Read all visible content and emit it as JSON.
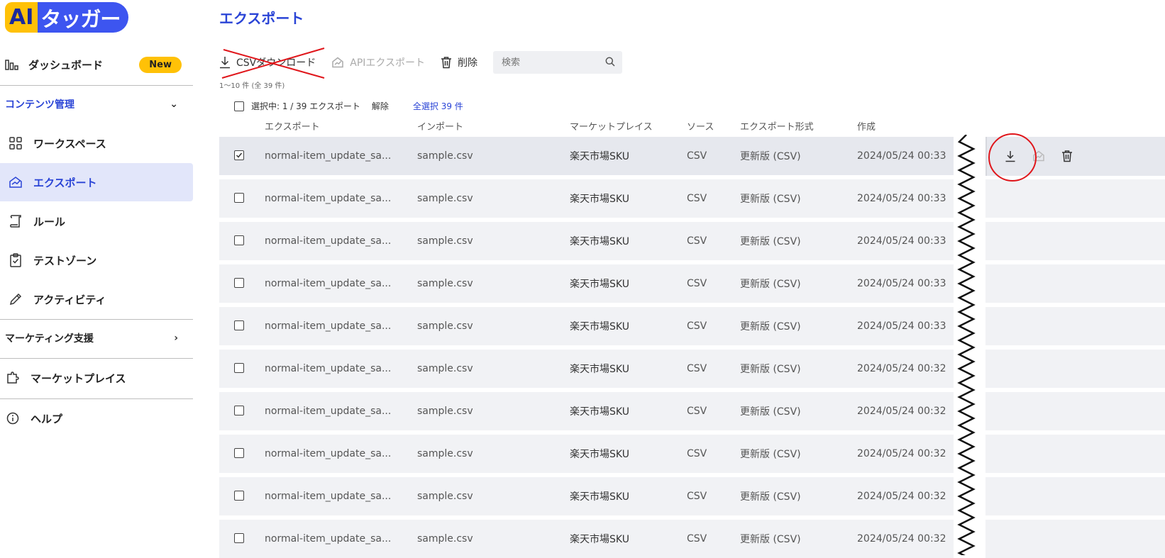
{
  "logo": {
    "ai": "AI",
    "name": "タッガー"
  },
  "sidebar": {
    "dashboard": {
      "label": "ダッシュボード",
      "badge": "New"
    },
    "content_section": "コンテンツ管理",
    "items": [
      {
        "label": "ワークスペース",
        "icon": "grid-icon"
      },
      {
        "label": "エクスポート",
        "icon": "export-icon"
      },
      {
        "label": "ルール",
        "icon": "scroll-icon"
      },
      {
        "label": "テストゾーン",
        "icon": "clipboard-check-icon"
      },
      {
        "label": "アクティビティ",
        "icon": "pencil-icon"
      }
    ],
    "marketing_section": "マーケティング支援",
    "marketplace": "マーケットプレイス",
    "help": "ヘルプ"
  },
  "page": {
    "title": "エクスポート"
  },
  "toolbar": {
    "csv_download": "CSVダウンロード",
    "api_export": "APIエクスポート",
    "delete": "削除",
    "search_placeholder": "検索",
    "range": "1〜10 件 (全 39 件)"
  },
  "selection": {
    "label": "選択中: 1 / 39 エクスポート",
    "clear": "解除",
    "select_all": "全選択 39 件"
  },
  "columns": [
    "エクスポート",
    "インポート",
    "マーケットプレイス",
    "ソース",
    "エクスポート形式",
    "作成"
  ],
  "rows": [
    {
      "export": "normal-item_update_sa...",
      "import": "sample.csv",
      "marketplace": "楽天市場SKU",
      "source": "CSV",
      "format": "更新版 (CSV)",
      "created": "2024/05/24 00:33",
      "checked": true
    },
    {
      "export": "normal-item_update_sa...",
      "import": "sample.csv",
      "marketplace": "楽天市場SKU",
      "source": "CSV",
      "format": "更新版 (CSV)",
      "created": "2024/05/24 00:33",
      "checked": false
    },
    {
      "export": "normal-item_update_sa...",
      "import": "sample.csv",
      "marketplace": "楽天市場SKU",
      "source": "CSV",
      "format": "更新版 (CSV)",
      "created": "2024/05/24 00:33",
      "checked": false
    },
    {
      "export": "normal-item_update_sa...",
      "import": "sample.csv",
      "marketplace": "楽天市場SKU",
      "source": "CSV",
      "format": "更新版 (CSV)",
      "created": "2024/05/24 00:33",
      "checked": false
    },
    {
      "export": "normal-item_update_sa...",
      "import": "sample.csv",
      "marketplace": "楽天市場SKU",
      "source": "CSV",
      "format": "更新版 (CSV)",
      "created": "2024/05/24 00:33",
      "checked": false
    },
    {
      "export": "normal-item_update_sa...",
      "import": "sample.csv",
      "marketplace": "楽天市場SKU",
      "source": "CSV",
      "format": "更新版 (CSV)",
      "created": "2024/05/24 00:32",
      "checked": false
    },
    {
      "export": "normal-item_update_sa...",
      "import": "sample.csv",
      "marketplace": "楽天市場SKU",
      "source": "CSV",
      "format": "更新版 (CSV)",
      "created": "2024/05/24 00:32",
      "checked": false
    },
    {
      "export": "normal-item_update_sa...",
      "import": "sample.csv",
      "marketplace": "楽天市場SKU",
      "source": "CSV",
      "format": "更新版 (CSV)",
      "created": "2024/05/24 00:32",
      "checked": false
    },
    {
      "export": "normal-item_update_sa...",
      "import": "sample.csv",
      "marketplace": "楽天市場SKU",
      "source": "CSV",
      "format": "更新版 (CSV)",
      "created": "2024/05/24 00:32",
      "checked": false
    },
    {
      "export": "normal-item_update_sa...",
      "import": "sample.csv",
      "marketplace": "楽天市場SKU",
      "source": "CSV",
      "format": "更新版 (CSV)",
      "created": "2024/05/24 00:32",
      "checked": false
    }
  ],
  "row_actions": {
    "download_icon": "download-icon",
    "api_export_icon": "export-icon",
    "delete_icon": "trash-icon"
  },
  "colors": {
    "primary": "#2A44D6",
    "accent": "#FFC107",
    "highlight": "#E0161B"
  }
}
